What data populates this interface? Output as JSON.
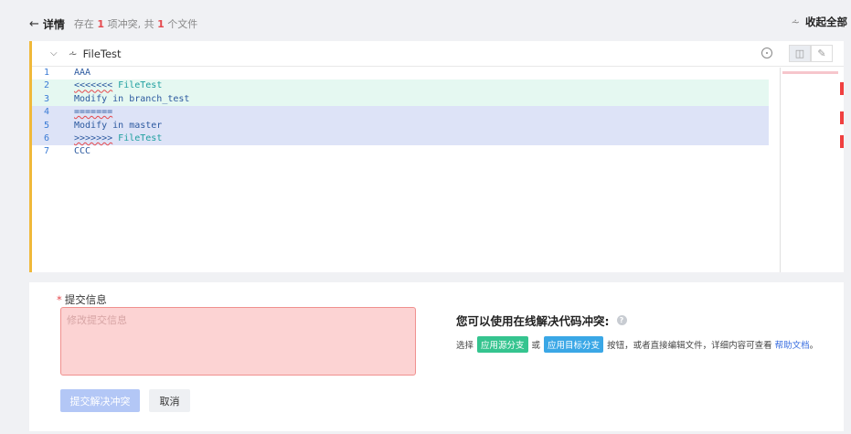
{
  "header": {
    "back_arrow": "←",
    "title": "详情",
    "summary_prefix": "存在",
    "conflict_count": "1",
    "summary_middle": "项冲突, 共",
    "file_count": "1",
    "summary_suffix": "个文件",
    "collapse_all": "收起全部"
  },
  "file": {
    "name": "FileTest",
    "lines": [
      {
        "num": "1",
        "text": "AAA"
      },
      {
        "num": "2",
        "marker": "<<<<<<<",
        "ref": " FileTest"
      },
      {
        "num": "3",
        "text": "Modify in branch_test"
      },
      {
        "num": "4",
        "marker": "======="
      },
      {
        "num": "5",
        "text": "Modify in master"
      },
      {
        "num": "6",
        "marker": ">>>>>>>",
        "ref": " FileTest"
      },
      {
        "num": "7",
        "text": "CCC"
      }
    ]
  },
  "form": {
    "label": "提交信息",
    "required_mark": "*",
    "placeholder": "修改提交信息",
    "submit": "提交解决冲突",
    "cancel": "取消"
  },
  "help": {
    "title": "您可以使用在线解决代码冲突:",
    "choose": "选择",
    "apply_source": "应用源分支",
    "or": "或",
    "apply_target": "应用目标分支",
    "rest": "按钮，或者直接编辑文件，详细内容可查看",
    "link": "帮助文档",
    "end": "。"
  },
  "colors": {
    "accent": "#f0b93a",
    "source_bg": "#e5f8f1",
    "target_bg": "#dde3f7",
    "conflict": "#e5484d"
  },
  "icons": [
    "back-arrow-icon",
    "fold-icon",
    "chevron-down-icon",
    "target-icon",
    "split-view-icon",
    "edit-icon",
    "help-icon"
  ]
}
